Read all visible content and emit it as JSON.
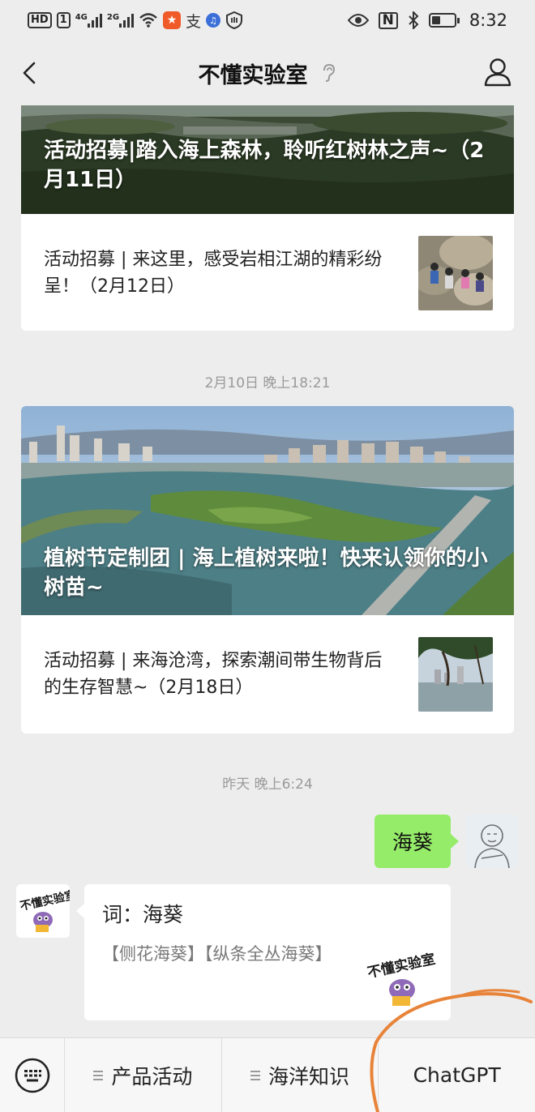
{
  "status_bar": {
    "hd_label": "HD",
    "sim_label": "1",
    "signal1_tag": "4G",
    "signal2_tag": "2G",
    "nfc_label": "N",
    "time": "8:32"
  },
  "header": {
    "title": "不懂实验室"
  },
  "article_groups": [
    {
      "cover_title": "活动招募|踏入海上森林，聆听红树林之声~（2月11日）",
      "items": [
        {
          "title": "活动招募 | 来这里，感受岩相江湖的精彩纷呈！（2月12日）"
        }
      ]
    },
    {
      "timestamp": "2月10日 晚上18:21",
      "cover_title": "植树节定制团 | 海上植树来啦！快来认领你的小树苗~",
      "items": [
        {
          "title": "活动招募 | 来海沧湾，探索潮间带生物背后的生存智慧~（2月18日）"
        }
      ]
    }
  ],
  "timestamp_yesterday": "昨天 晚上6:24",
  "outgoing_message": "海葵",
  "incoming_message": {
    "word_line": "词：海葵",
    "meaning_line": "【侧花海葵】【纵条全丛海葵】"
  },
  "bottom_menu": {
    "items": [
      {
        "label": "产品活动",
        "has_submenu": true
      },
      {
        "label": "海洋知识",
        "has_submenu": true
      },
      {
        "label": "ChatGPT",
        "has_submenu": false
      }
    ]
  },
  "colors": {
    "background": "#ededed",
    "outgoing_bubble": "#95ec69",
    "annotation_stroke": "#e8843a"
  }
}
